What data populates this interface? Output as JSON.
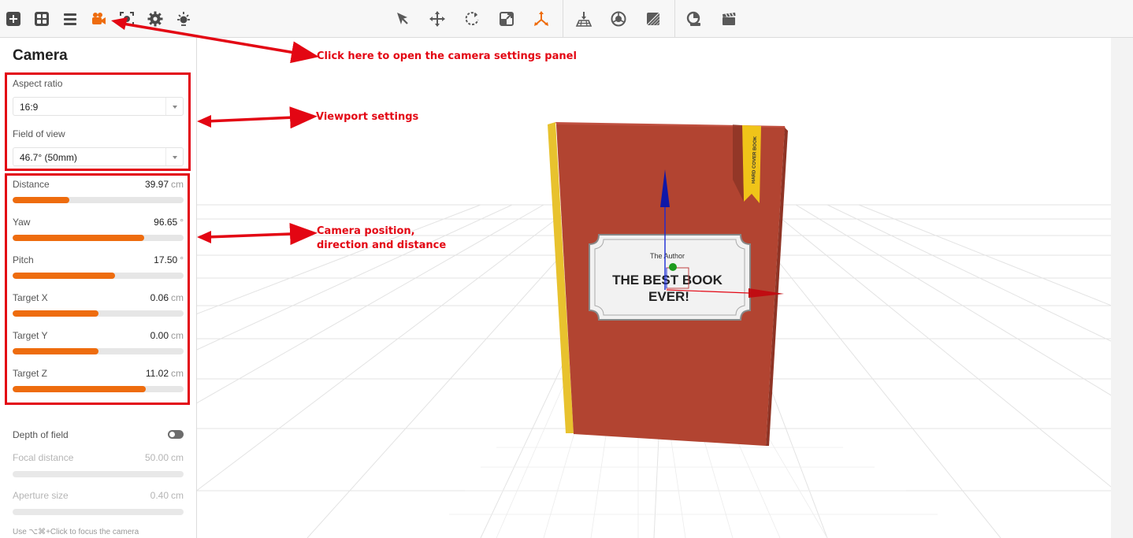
{
  "toolbar": {
    "left_icons": [
      "add-icon",
      "grid-icon",
      "menu-icon",
      "camera-icon",
      "focus-icon",
      "gear-icon",
      "light-icon"
    ],
    "center_icons": [
      "select-arrow-icon",
      "move-icon",
      "rotate-icon",
      "scale-icon",
      "transform-axis-icon"
    ],
    "right_icons_1": [
      "floor-icon",
      "material-sphere-icon",
      "texture-icon"
    ],
    "right_icons_2": [
      "render-icon",
      "clapperboard-icon"
    ],
    "accent_color": "#ee6c0e"
  },
  "panel": {
    "title": "Camera",
    "aspect_ratio": {
      "label": "Aspect ratio",
      "value": "16:9"
    },
    "field_of_view": {
      "label": "Field of view",
      "value": "46.7° (50mm)"
    },
    "sliders": [
      {
        "label": "Distance",
        "value": "39.97",
        "unit": "cm",
        "fill": 0.33
      },
      {
        "label": "Yaw",
        "value": "96.65",
        "unit": "°",
        "fill": 0.77
      },
      {
        "label": "Pitch",
        "value": "17.50",
        "unit": "°",
        "fill": 0.6
      },
      {
        "label": "Target X",
        "value": "0.06",
        "unit": "cm",
        "fill": 0.5
      },
      {
        "label": "Target Y",
        "value": "0.00",
        "unit": "cm",
        "fill": 0.5
      },
      {
        "label": "Target Z",
        "value": "11.02",
        "unit": "cm",
        "fill": 0.78
      }
    ],
    "depth_of_field": {
      "label": "Depth of field",
      "enabled": false
    },
    "focal_distance": {
      "label": "Focal distance",
      "value": "50.00",
      "unit": "cm"
    },
    "aperture_size": {
      "label": "Aperture size",
      "value": "0.40",
      "unit": "cm"
    },
    "hint": "Use ⌥⌘+Click to focus the camera"
  },
  "book": {
    "author": "The Author",
    "title_line1": "THE BEST BOOK",
    "title_line2": "EVER!",
    "ribbon": "HARD COVER BOOK",
    "cover_color": "#b24431",
    "spine_color": "#e8c22e"
  },
  "annotations": {
    "open_panel": "Click here to open the camera settings panel",
    "viewport_settings": "Viewport settings",
    "camera_line1": "Camera position,",
    "camera_line2": "direction and distance",
    "color": "#e30613"
  }
}
